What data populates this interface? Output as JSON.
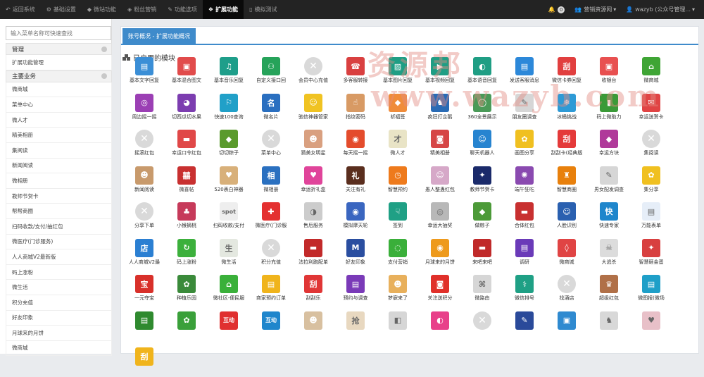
{
  "topbar": {
    "tabs": [
      {
        "icon": "back-icon",
        "glyph": "↶",
        "label": "返回系统",
        "active": false
      },
      {
        "icon": "gear-icon",
        "glyph": "⚙",
        "label": "基础设置",
        "active": false
      },
      {
        "icon": "cube-icon",
        "glyph": "◆",
        "label": "微站功能",
        "active": false
      },
      {
        "icon": "comment-icon",
        "glyph": "◈",
        "label": "粉丝营销",
        "active": false
      },
      {
        "icon": "options-icon",
        "glyph": "✎",
        "label": "功能选项",
        "active": false
      },
      {
        "icon": "cubes-icon",
        "glyph": "❖",
        "label": "扩展功能",
        "active": true
      },
      {
        "icon": "phone-icon",
        "glyph": "▯",
        "label": "模拟测试",
        "active": false
      }
    ],
    "bell_count": "0",
    "group_label": "营销资源网",
    "user_label": "wazyb (公众号管理..."
  },
  "sidebar": {
    "search_placeholder": "输入菜单名称可快速查找",
    "group1_title": "管理",
    "group1_items": [
      "扩展功能管理"
    ],
    "group2_title": "主要业务",
    "group2_items": [
      "微商城",
      "菜单中心",
      "微人才",
      "精美相册",
      "集阅读",
      "新闻阅读",
      "微相册",
      "教师节贺卡",
      "帮帮商圈",
      "扫码收款/支付/抽红包",
      "微医疗(门诊服务)",
      "人人商城V2最新版",
      "码上涨粉",
      "微生活",
      "积分充值",
      "好友印象",
      "月球来的月饼",
      "微商城"
    ]
  },
  "main": {
    "tab_label": "账号概况 - 扩展功能概况",
    "section_title": "已启用的模块",
    "watermark_line1": "资源邦",
    "watermark_line2": "www.wazyb.com",
    "modules": [
      {
        "label": "基本文字回复",
        "color": "#3a8ed6",
        "glyph": "▤"
      },
      {
        "label": "基本混合图文",
        "color": "#e14b4b",
        "glyph": "▣"
      },
      {
        "label": "基本音乐回复",
        "color": "#1e9e8a",
        "glyph": "♫"
      },
      {
        "label": "自定义接口回",
        "color": "#26a35a",
        "glyph": "⚇"
      },
      {
        "label": "会员中心充值",
        "color": "x",
        "glyph": "✕"
      },
      {
        "label": "多客服转接",
        "color": "#d94040",
        "glyph": "☎"
      },
      {
        "label": "基本图片回复",
        "color": "#1f9e84",
        "glyph": "▨"
      },
      {
        "label": "基本视频回复",
        "color": "#1f9e84",
        "glyph": "▶"
      },
      {
        "label": "基本语音回复",
        "color": "#1f9e84",
        "glyph": "◐"
      },
      {
        "label": "发送客服消息",
        "color": "#2c88d9",
        "glyph": "▤"
      },
      {
        "label": "微信卡券回复",
        "color": "#e13f3f",
        "glyph": "刮"
      },
      {
        "label": "收银台",
        "color": "#e85050",
        "glyph": "▣"
      },
      {
        "label": "微商城",
        "color": "#3fa535",
        "glyph": "⌂"
      },
      {
        "label": "周边摇一摇",
        "color": "#9b3fb4",
        "glyph": "◎"
      },
      {
        "label": "切西瓜切水果",
        "color": "#7c3db0",
        "glyph": "◕"
      },
      {
        "label": "快速100查询",
        "color": "#21a0c8",
        "glyph": "⚐"
      },
      {
        "label": "微名片",
        "color": "#2a6fc0",
        "glyph": "名"
      },
      {
        "label": "驰信神器管家",
        "color": "#f0c322",
        "glyph": "☺"
      },
      {
        "label": "指纹密码",
        "color": "#d89a64",
        "glyph": "☝"
      },
      {
        "label": "祈福签",
        "color": "#f08c3a",
        "glyph": "◆"
      },
      {
        "label": "疯狂打企鹅",
        "color": "#2a6bb5",
        "glyph": "♞"
      },
      {
        "label": "360全景展示",
        "color": "#4a9a58",
        "glyph": "◯"
      },
      {
        "label": "朋友圈调查",
        "color": "#d6d6d6",
        "glyph": "✎"
      },
      {
        "label": "冰桶挑战",
        "color": "#2e9ad6",
        "glyph": "❄"
      },
      {
        "label": "码上微助力",
        "color": "#3b9a38",
        "glyph": "▮"
      },
      {
        "label": "幸运送贺卡",
        "color": "#e04444",
        "glyph": "✉"
      },
      {
        "label": "摇滚红包",
        "color": "x",
        "glyph": "✕"
      },
      {
        "label": "幸运口令红包",
        "color": "#e04848",
        "glyph": "▬"
      },
      {
        "label": "切切粽子",
        "color": "#5a9a2c",
        "glyph": "◆"
      },
      {
        "label": "菜单中心",
        "color": "x",
        "glyph": "✕"
      },
      {
        "label": "猜美女明星",
        "color": "#d9a080",
        "glyph": "☻"
      },
      {
        "label": "每天摇一摇",
        "color": "#e44c2c",
        "glyph": "◉"
      },
      {
        "label": "微人才",
        "color": "#e9e4c6",
        "glyph": "才"
      },
      {
        "label": "精美相册",
        "color": "#d64646",
        "glyph": "◙"
      },
      {
        "label": "聊天机器人",
        "color": "#2784d0",
        "glyph": "☺"
      },
      {
        "label": "画图分享",
        "color": "#f0c020",
        "glyph": "✿"
      },
      {
        "label": "刮刮卡(经典版",
        "color": "#e43a3a",
        "glyph": "刮"
      },
      {
        "label": "幸运方块",
        "color": "#b03a9a",
        "glyph": "◆"
      },
      {
        "label": "集阅读",
        "color": "x",
        "glyph": "✕"
      },
      {
        "label": "新闻阅读",
        "color": "#c89a6c",
        "glyph": "☻"
      },
      {
        "label": "微喜帖",
        "color": "#c83030",
        "glyph": "囍"
      },
      {
        "label": "520表白神器",
        "color": "#d8b07a",
        "glyph": "♥"
      },
      {
        "label": "微相册",
        "color": "#2a70c0",
        "glyph": "相"
      },
      {
        "label": "幸运折礼盒",
        "color": "#e0449a",
        "glyph": "♥"
      },
      {
        "label": "关注有礼",
        "color": "#5a2e1e",
        "glyph": "礼"
      },
      {
        "label": "智慧预约",
        "color": "#ee7a1c",
        "glyph": "◷"
      },
      {
        "label": "愚人整蛊红包",
        "color": "#d6a8c8",
        "glyph": "☺"
      },
      {
        "label": "教师节贺卡",
        "color": "#1a2a6a",
        "glyph": "✦"
      },
      {
        "label": "端午狂吃",
        "color": "#8a4ab0",
        "glyph": "✺"
      },
      {
        "label": "智慧商圈",
        "color": "#e8800c",
        "glyph": "♜"
      },
      {
        "label": "男女配发调查",
        "color": "#d6d6d6",
        "glyph": "✎"
      },
      {
        "label": "集分享",
        "color": "#f0c020",
        "glyph": "✿"
      },
      {
        "label": "分享下单",
        "color": "x",
        "glyph": "✕"
      },
      {
        "label": "小猴摘桃",
        "color": "#c63a5a",
        "glyph": "♣"
      },
      {
        "label": "扫码收款/支付",
        "color": "#eeeeee",
        "glyph": "spot"
      },
      {
        "label": "微医疗(门诊服",
        "color": "#e43030",
        "glyph": "✚"
      },
      {
        "label": "售后服务",
        "color": "#ccc",
        "glyph": "◑"
      },
      {
        "label": "模拟摩天轮",
        "color": "#3a66c0",
        "glyph": "◉"
      },
      {
        "label": "签到",
        "color": "#1fa085",
        "glyph": "☟"
      },
      {
        "label": "幸运大抽奖",
        "color": "#b8b8b8",
        "glyph": "◎"
      },
      {
        "label": "做粽子",
        "color": "#4c9a38",
        "glyph": "◆"
      },
      {
        "label": "合体红包",
        "color": "#c83030",
        "glyph": "▬"
      },
      {
        "label": "人脸识别",
        "color": "#2a60b0",
        "glyph": "☺"
      },
      {
        "label": "快速专家",
        "color": "#1f86cc",
        "glyph": "快"
      },
      {
        "label": "万能表单",
        "color": "#e6eef8",
        "glyph": "▤"
      },
      {
        "label": "人人商城V2最",
        "color": "#2b7fd2",
        "glyph": "店"
      },
      {
        "label": "码上涨粉",
        "color": "#3cb03c",
        "glyph": "↻"
      },
      {
        "label": "微生活",
        "color": "#e4e8e0",
        "glyph": "生"
      },
      {
        "label": "积分充值",
        "color": "x",
        "glyph": "✕"
      },
      {
        "label": "法拉利跑配单",
        "color": "#c22a2a",
        "glyph": "▬"
      },
      {
        "label": "好友印象",
        "color": "#2a4ea0",
        "glyph": "M"
      },
      {
        "label": "支付营销",
        "color": "#3aaf3a",
        "glyph": "◌"
      },
      {
        "label": "月球来的月饼",
        "color": "#ee9a1c",
        "glyph": "◉"
      },
      {
        "label": "来吧来吧",
        "color": "#c02a2a",
        "glyph": "▬"
      },
      {
        "label": "调研",
        "color": "#6a3ab8",
        "glyph": "▤"
      },
      {
        "label": "微商城",
        "color": "#e04444",
        "glyph": "◊"
      },
      {
        "label": "大逃杀",
        "color": "#dcdcdc",
        "glyph": "☠"
      },
      {
        "label": "智慧砸金蛋",
        "color": "#d84040",
        "glyph": "✦"
      },
      {
        "label": "一元夺宝",
        "color": "#d8302a",
        "glyph": "宝"
      },
      {
        "label": "种植乐园",
        "color": "#3a8a3a",
        "glyph": "✿"
      },
      {
        "label": "微社区-便民服",
        "color": "#3ab03a",
        "glyph": "⌂"
      },
      {
        "label": "商家预约订单",
        "color": "#f0b41c",
        "glyph": "▤"
      },
      {
        "label": "刮刮乐",
        "color": "#e03636",
        "glyph": "刮"
      },
      {
        "label": "预约与调查",
        "color": "#7a3ab8",
        "glyph": "▤"
      },
      {
        "label": "梦寐来了",
        "color": "#e8b05c",
        "glyph": "☻"
      },
      {
        "label": "关注送积分",
        "color": "#e0302a",
        "glyph": "◙"
      },
      {
        "label": "微路由",
        "color": "#d6d6d6",
        "glyph": "⌘"
      },
      {
        "label": "微信排号",
        "color": "#1fa085",
        "glyph": "⚕"
      },
      {
        "label": "找酒店",
        "color": "x",
        "glyph": "✕"
      },
      {
        "label": "超级红包",
        "color": "#b07048",
        "glyph": "♛"
      },
      {
        "label": "微图报(微场",
        "color": "#1f9fc8",
        "glyph": "▤"
      },
      {
        "label": "",
        "color": "#2f8a2f",
        "glyph": "▤"
      },
      {
        "label": "",
        "color": "#3aa03a",
        "glyph": "✿"
      },
      {
        "label": "",
        "color": "#e03030",
        "glyph": "互动"
      },
      {
        "label": "",
        "color": "#1f86cc",
        "glyph": "互动"
      },
      {
        "label": "",
        "color": "#d8c0a0",
        "glyph": "☻"
      },
      {
        "label": "",
        "color": "#e8d8c0",
        "glyph": "抢"
      },
      {
        "label": "",
        "color": "#d6d6d6",
        "glyph": "◧"
      },
      {
        "label": "",
        "color": "#e8408a",
        "glyph": "◐"
      },
      {
        "label": "",
        "color": "x",
        "glyph": "✕"
      },
      {
        "label": "",
        "color": "#2a4a9a",
        "glyph": "✎"
      },
      {
        "label": "",
        "color": "#2f8ad0",
        "glyph": "▣"
      },
      {
        "label": "",
        "color": "#d8d8d8",
        "glyph": "♞"
      },
      {
        "label": "",
        "color": "#e8c0c8",
        "glyph": "♥"
      },
      {
        "label": "",
        "color": "#f0b41c",
        "glyph": "刮"
      }
    ]
  }
}
